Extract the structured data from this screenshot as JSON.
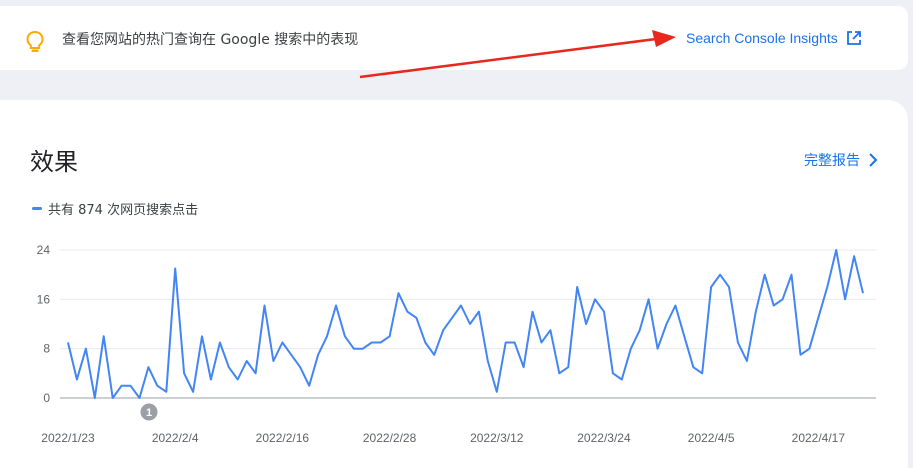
{
  "banner": {
    "text": "查看您网站的热门查询在 Google 搜索中的表现",
    "link_label": "Search Console Insights"
  },
  "performance": {
    "title": "效果",
    "full_report_label": "完整报告",
    "legend_label": "共有 874 次网页搜索点击"
  },
  "annotation": {
    "label": "1"
  },
  "colors": {
    "accent": "#1a73e8",
    "series": "#4285f4",
    "bulb": "#f9ab00",
    "arrow": "#e8281e"
  },
  "chart_data": {
    "type": "line",
    "title": "",
    "xlabel": "",
    "ylabel": "",
    "ylim": [
      0,
      24
    ],
    "yticks": [
      0,
      8,
      16,
      24
    ],
    "grid": true,
    "x_tick_labels": [
      "2022/1/23",
      "2022/2/4",
      "2022/2/16",
      "2022/2/28",
      "2022/3/12",
      "2022/3/24",
      "2022/4/5",
      "2022/4/17"
    ],
    "x_start": "2022/1/23",
    "series": [
      {
        "name": "",
        "values": [
          9,
          3,
          8,
          0,
          10,
          0,
          2,
          2,
          0,
          5,
          2,
          1,
          21,
          4,
          1,
          10,
          3,
          9,
          5,
          3,
          6,
          4,
          15,
          6,
          9,
          7,
          5,
          2,
          7,
          10,
          15,
          10,
          8,
          8,
          9,
          9,
          10,
          17,
          14,
          13,
          9,
          7,
          11,
          13,
          15,
          12,
          14,
          6,
          1,
          9,
          9,
          5,
          14,
          9,
          11,
          4,
          5,
          18,
          12,
          16,
          14,
          4,
          3,
          8,
          11,
          16,
          8,
          12,
          15,
          10,
          5,
          4,
          18,
          20,
          18,
          9,
          6,
          14,
          20,
          15,
          16,
          20,
          7,
          8,
          13,
          18,
          24,
          16,
          23,
          17
        ]
      }
    ]
  }
}
